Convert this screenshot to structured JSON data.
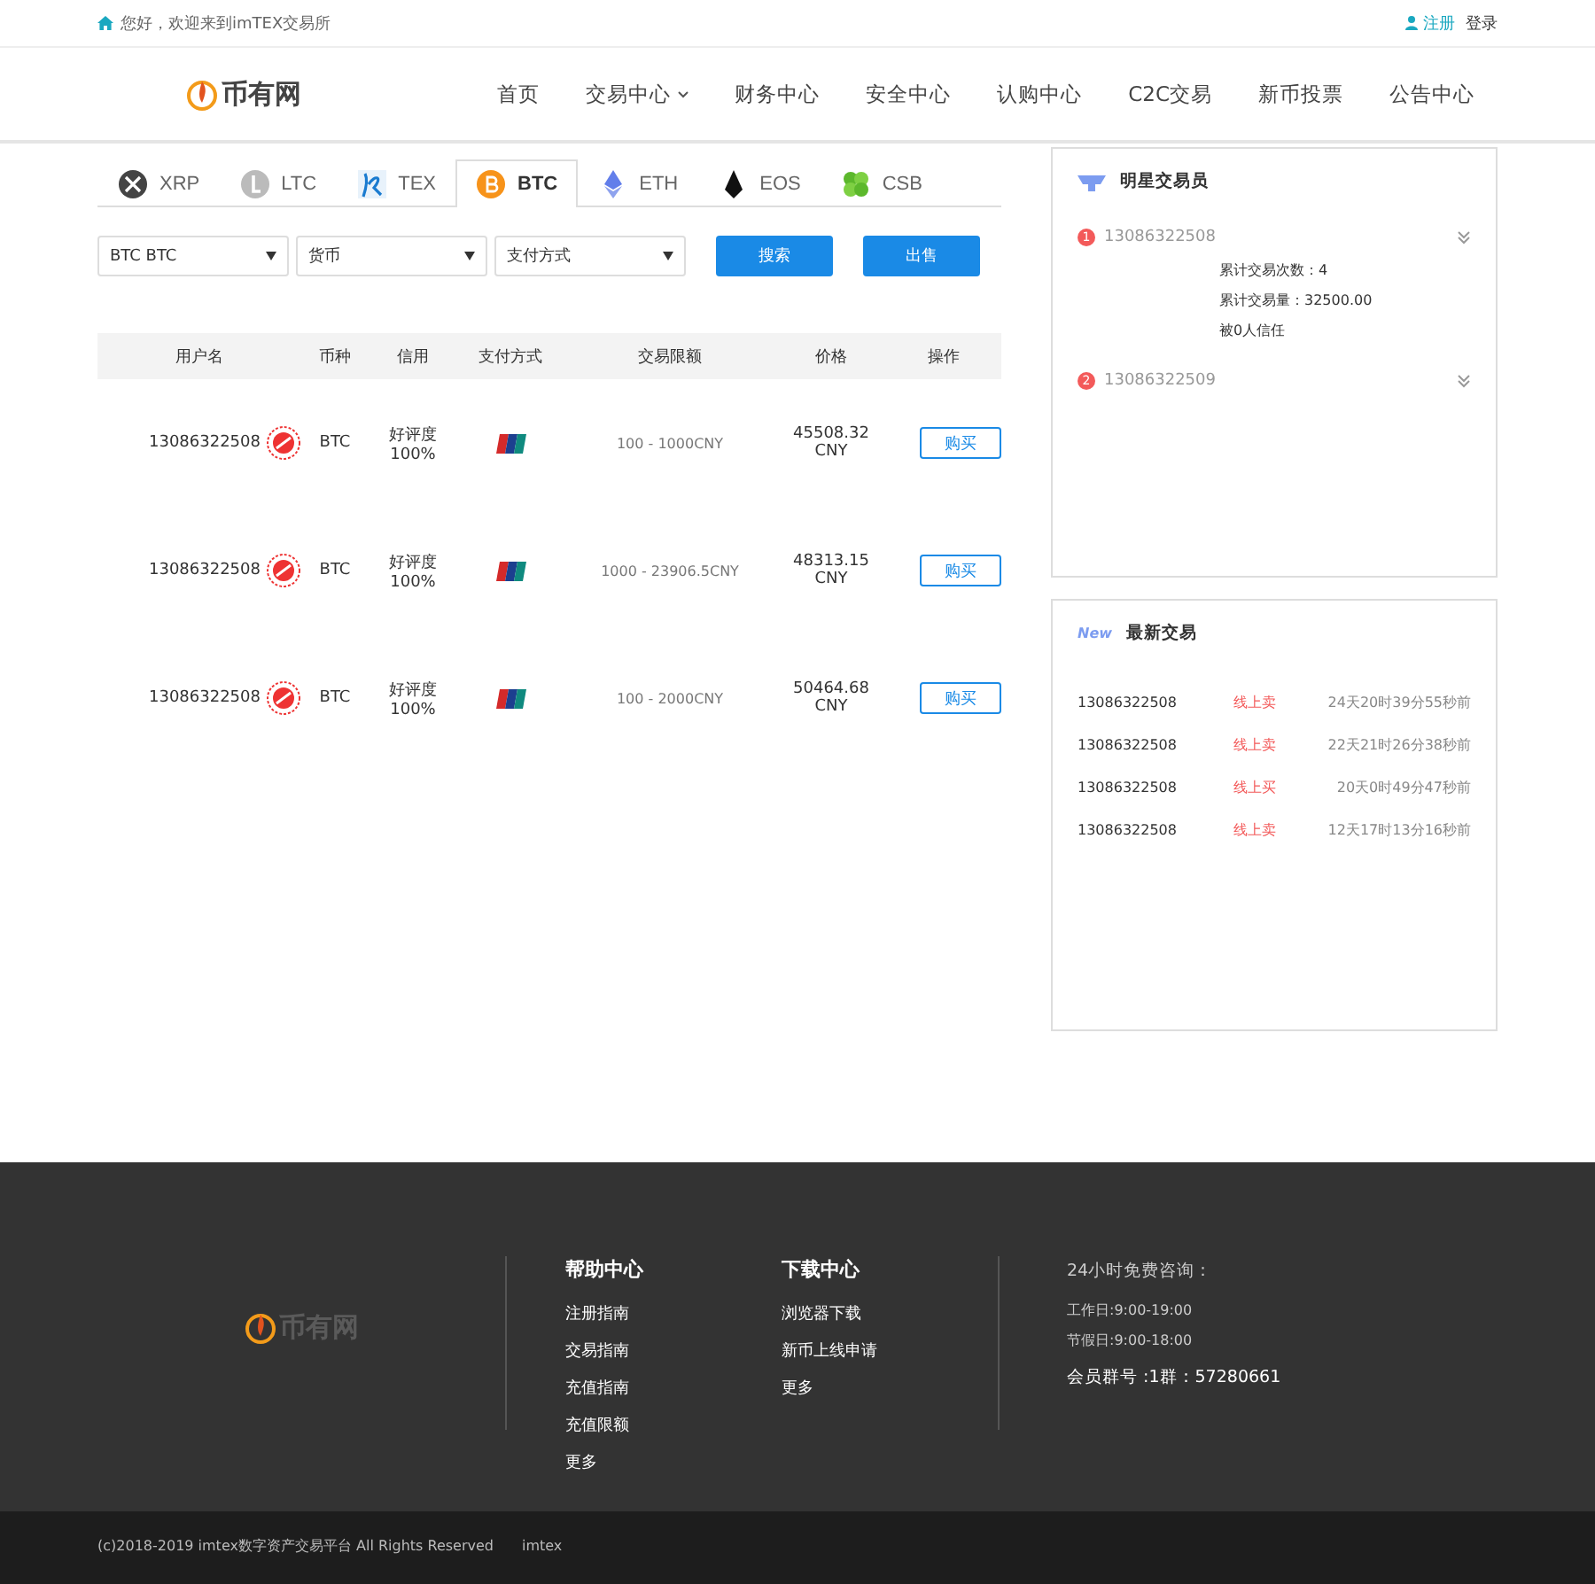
{
  "topbar": {
    "greeting": "您好，欢迎来到imTEX交易所",
    "register": "注册",
    "login": "登录"
  },
  "header": {
    "logo": "币有网",
    "nav": [
      {
        "label": "首页",
        "dropdown": false
      },
      {
        "label": "交易中心",
        "dropdown": true
      },
      {
        "label": "财务中心",
        "dropdown": false
      },
      {
        "label": "安全中心",
        "dropdown": false
      },
      {
        "label": "认购中心",
        "dropdown": false
      },
      {
        "label": "C2C交易",
        "dropdown": false
      },
      {
        "label": "新币投票",
        "dropdown": false
      },
      {
        "label": "公告中心",
        "dropdown": false
      }
    ]
  },
  "coin_tabs": [
    {
      "label": "XRP",
      "selected": false
    },
    {
      "label": "LTC",
      "selected": false
    },
    {
      "label": "TEX",
      "selected": false
    },
    {
      "label": "BTC",
      "selected": true
    },
    {
      "label": "ETH",
      "selected": false
    },
    {
      "label": "EOS",
      "selected": false
    },
    {
      "label": "CSB",
      "selected": false
    }
  ],
  "filters": [
    {
      "value": "BTC BTC"
    },
    {
      "value": "货币"
    },
    {
      "value": "支付方式"
    }
  ],
  "buttons": [
    "搜索",
    "出售"
  ],
  "table": {
    "columns": [
      "用户名",
      "币种",
      "信用",
      "支付方式",
      "交易限额",
      "价格",
      "操作"
    ],
    "rows": [
      {
        "user": "13086322508",
        "coin": "BTC",
        "credit": "好评度",
        "rate": "100%",
        "limit": "100 - 1000CNY",
        "price": "45508.32",
        "currency": "CNY",
        "action": "购买"
      },
      {
        "user": "13086322508",
        "coin": "BTC",
        "credit": "好评度",
        "rate": "100%",
        "limit": "1000 - 23906.5CNY",
        "price": "48313.15",
        "currency": "CNY",
        "action": "购买"
      },
      {
        "user": "13086322508",
        "coin": "BTC",
        "credit": "好评度",
        "rate": "100%",
        "limit": "100 - 2000CNY",
        "price": "50464.68",
        "currency": "CNY",
        "action": "购买"
      }
    ]
  },
  "star_traders": {
    "title": "明星交易员",
    "traders": [
      {
        "rank": "1",
        "name": "13086322508",
        "expanded": true,
        "details": [
          "累计交易次数：4",
          "累计交易量：32500.00",
          "被0人信任"
        ]
      },
      {
        "rank": "2",
        "name": "13086322509",
        "expanded": false
      }
    ]
  },
  "latest_trades": {
    "badge": "New",
    "title": "最新交易",
    "rows": [
      {
        "user": "13086322508",
        "type": "线上卖",
        "time": "24天20时39分55秒前"
      },
      {
        "user": "13086322508",
        "type": "线上卖",
        "time": "22天21时26分38秒前"
      },
      {
        "user": "13086322508",
        "type": "线上买",
        "time": "20天0时49分47秒前"
      },
      {
        "user": "13086322508",
        "type": "线上卖",
        "time": "12天17时13分16秒前"
      }
    ]
  },
  "footer": {
    "logo": "币有网",
    "columns": [
      {
        "title": "帮助中心",
        "links": [
          "注册指南",
          "交易指南",
          "充值指南",
          "充值限额",
          "更多"
        ]
      },
      {
        "title": "下载中心",
        "links": [
          "浏览器下载",
          "新币上线申请",
          "更多"
        ]
      }
    ],
    "contact": {
      "title": "24小时免费咨询：",
      "lines": [
        "工作日:9:00-19:00",
        "节假日:9:00-18:00"
      ],
      "group": "会员群号 :1群：57280661"
    }
  },
  "copyright": {
    "text": "(c)2018-2019 imtex数字资产交易平台 All Rights Reserved",
    "brand": "imtex"
  }
}
